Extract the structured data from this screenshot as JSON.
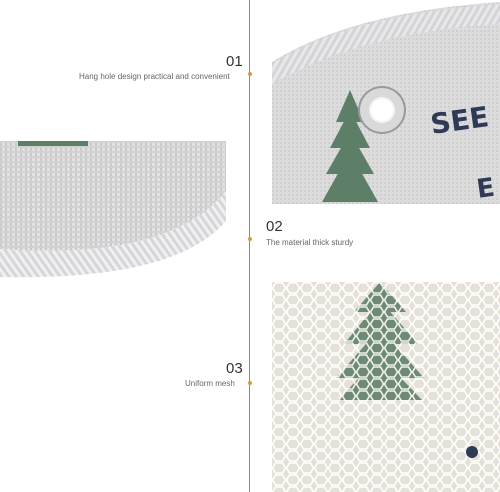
{
  "features": [
    {
      "number": "01",
      "caption": "Hang hole design practical and convenient"
    },
    {
      "number": "02",
      "caption": "The material thick sturdy"
    },
    {
      "number": "03",
      "caption": "Uniform mesh"
    }
  ],
  "photo1": {
    "print_text_1": "SEE",
    "print_text_2": "E"
  },
  "colors": {
    "accent_dot": "#d89a3a",
    "divider": "#8a8a8a",
    "tree_green": "#5e7f67",
    "navy_text": "#2f3a56"
  }
}
